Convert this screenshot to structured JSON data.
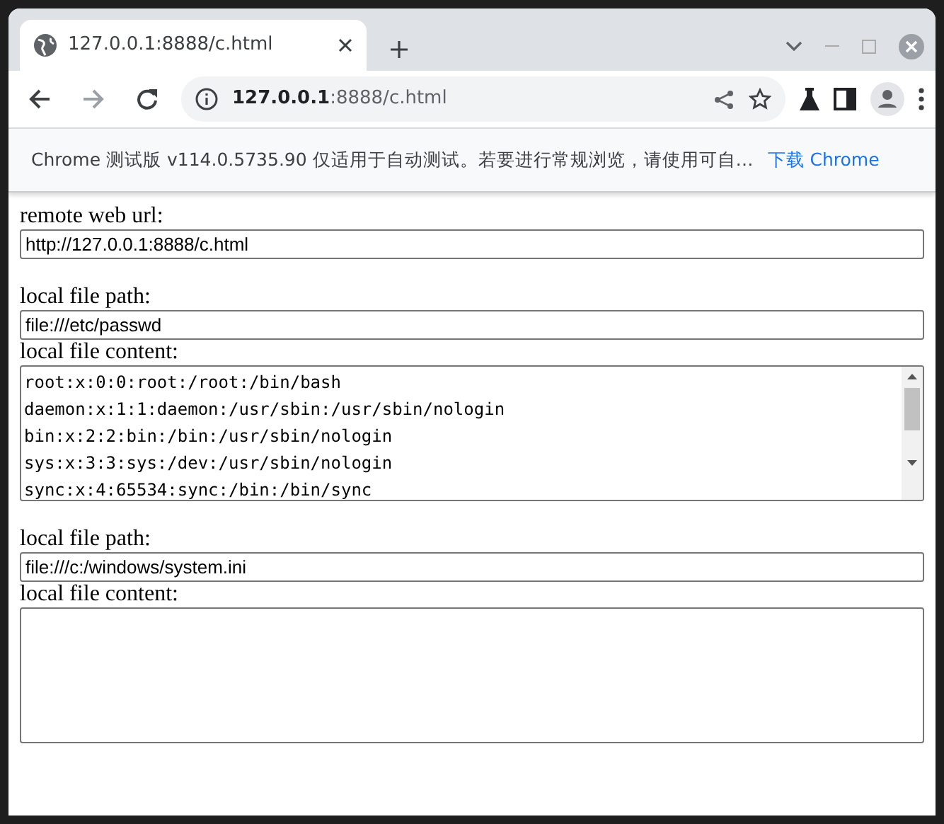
{
  "tab": {
    "title": "127.0.0.1:8888/c.html",
    "selected": true
  },
  "address": "**127.0.0.1**:8888/c.html",
  "infobar": {
    "message": "Chrome 测试版 v114.0.5735.90 仅适用于自动测试。若要进行常规浏览，请使用可自…",
    "link": "下载 Chrome"
  },
  "sections": [
    {
      "kind": "url",
      "label": "remote web url:",
      "value": "http://127.0.0.1:8888/c.html"
    },
    {
      "kind": "file",
      "label": "local file path:",
      "value": "file:///etc/passwd",
      "content_label": "local file content:",
      "content_lines": [
        "root:x:0:0:root:/root:/bin/bash",
        "daemon:x:1:1:daemon:/usr/sbin:/usr/sbin/nologin",
        "bin:x:2:2:bin:/bin:/usr/sbin/nologin",
        "sys:x:3:3:sys:/dev:/usr/sbin/nologin",
        "sync:x:4:65534:sync:/bin:/bin/sync"
      ]
    },
    {
      "kind": "file",
      "label": "local file path:",
      "value": "file:///c:/windows/system.ini",
      "content_label": "local file content:"
    }
  ]
}
